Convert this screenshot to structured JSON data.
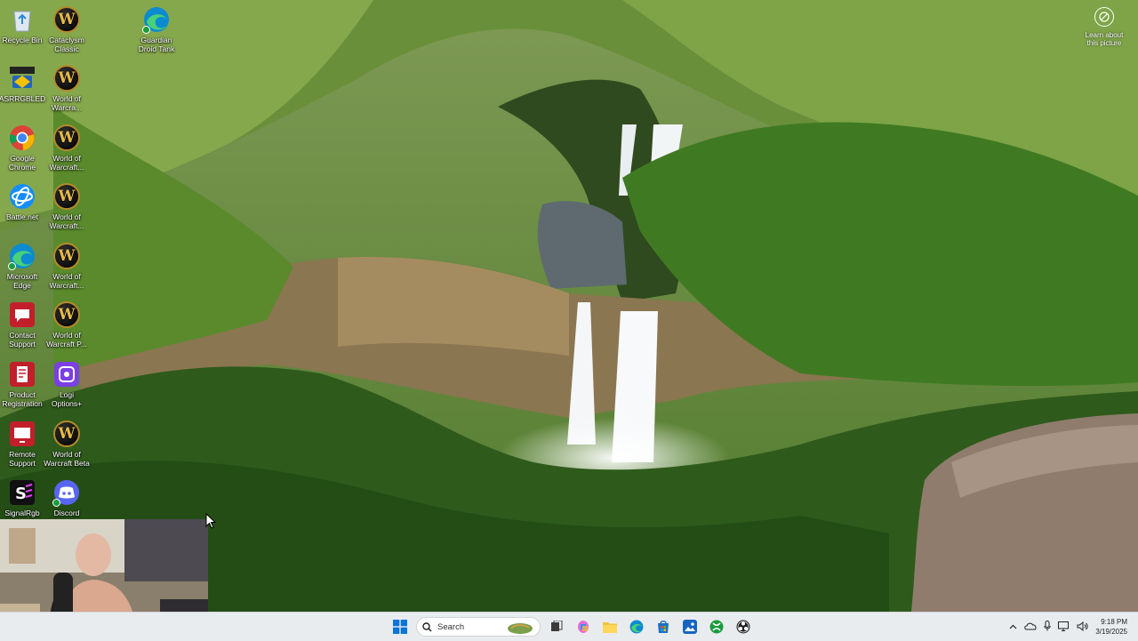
{
  "desktop": {
    "icons": [
      {
        "label": "Recycle Bin",
        "icon": "recycle-bin-icon"
      },
      {
        "label": "Cataclysm\nClassic",
        "icon": "wow-icon"
      },
      {
        "label": "Guardian\nDroid Tank",
        "icon": "edge-icon"
      },
      {
        "label": "ASRRGBLED",
        "icon": "asrock-icon"
      },
      {
        "label": "World of\nWarcra...",
        "icon": "wow-icon"
      },
      {
        "label": "Google\nChrome",
        "icon": "chrome-icon"
      },
      {
        "label": "World of\nWarcraft...",
        "icon": "wow-icon"
      },
      {
        "label": "Battle.net",
        "icon": "battlenet-icon"
      },
      {
        "label": "World of\nWarcraft...",
        "icon": "wow-icon"
      },
      {
        "label": "Microsoft\nEdge",
        "icon": "edge-icon"
      },
      {
        "label": "World of\nWarcraft...",
        "icon": "wow-icon"
      },
      {
        "label": "Contact\nSupport",
        "icon": "contact-support-icon"
      },
      {
        "label": "World of\nWarcraft P...",
        "icon": "wow-icon"
      },
      {
        "label": "Product\nRegistration",
        "icon": "product-registration-icon"
      },
      {
        "label": "Logi\nOptions+",
        "icon": "logi-options-icon"
      },
      {
        "label": "Remote\nSupport",
        "icon": "remote-support-icon"
      },
      {
        "label": "World of\nWarcraft Beta",
        "icon": "wow-icon"
      },
      {
        "label": "SignalRgb",
        "icon": "signalrgb-icon"
      },
      {
        "label": "Discord",
        "icon": "discord-icon"
      }
    ],
    "wow_letter": "W",
    "learn_picture": "Learn about\nthis picture"
  },
  "taskbar": {
    "search_placeholder": "Search",
    "apps": [
      "start-icon",
      "search-icon",
      "task-view-icon",
      "copilot-icon",
      "file-explorer-icon",
      "edge-icon",
      "microsoft-store-icon",
      "photos-icon",
      "xbox-icon",
      "obs-icon"
    ],
    "tray": {
      "time": "9:18 PM",
      "date": "3/19/2025"
    }
  },
  "colors": {
    "taskbar_bg": "#e9ecef",
    "win_blue": "#0a74da",
    "wow_gold": "#b58a2a",
    "discord": "#5865f2"
  }
}
